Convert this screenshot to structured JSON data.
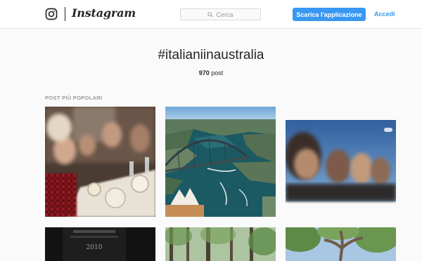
{
  "header": {
    "brand": "Instagram",
    "search_placeholder": "Cerca",
    "download_label": "Scarica l'applicazione",
    "login_label": "Accedi"
  },
  "hashtag": {
    "title": "#italianiinaustralia",
    "post_count": "970",
    "post_unit": "post"
  },
  "section": {
    "title": "POST PIÙ POPOLARI"
  },
  "posts": [
    {
      "subject": "group dinner photo"
    },
    {
      "subject": "aerial view of Sydney Harbour"
    },
    {
      "subject": "group outdoor selfie"
    },
    {
      "subject": "wine label",
      "visible_text": "2010"
    },
    {
      "subject": "trees in park"
    },
    {
      "subject": "tree branches"
    }
  ],
  "colors": {
    "accent": "#3897f0",
    "background": "#fafafa",
    "text": "#262626",
    "muted": "#999999"
  },
  "icons": {
    "logo": "instagram-glyph-icon",
    "search": "search-icon"
  }
}
